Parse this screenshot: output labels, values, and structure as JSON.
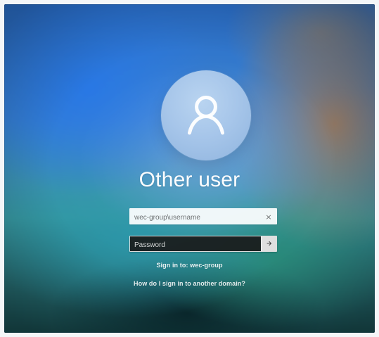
{
  "screen": {
    "title": "Other user"
  },
  "avatar": {
    "icon": "user-icon"
  },
  "username": {
    "placeholder": "wec-group\\username",
    "value": ""
  },
  "password": {
    "placeholder": "Password",
    "value": ""
  },
  "hints": {
    "sign_in_to": "Sign in to: wec-group",
    "other_domain": "How do I sign in to another domain?"
  },
  "icons": {
    "clear": "close-icon",
    "submit": "arrow-right-icon"
  }
}
